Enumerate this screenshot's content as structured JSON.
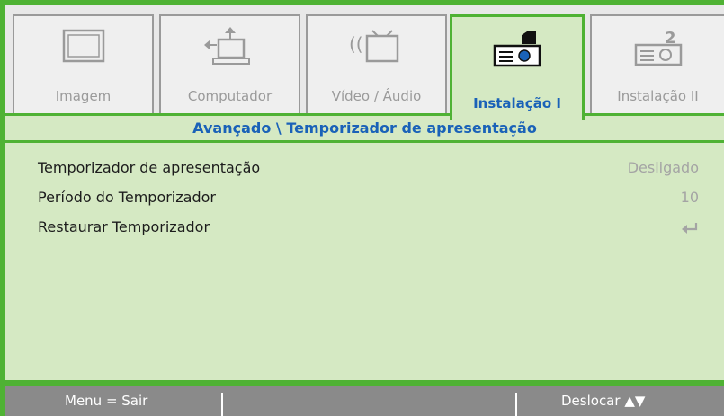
{
  "tabs": [
    {
      "label": "Imagem",
      "icon": "monitor-icon",
      "active": false
    },
    {
      "label": "Computador",
      "icon": "laptop-icon",
      "active": false
    },
    {
      "label": "Vídeo / Áudio",
      "icon": "video-audio-icon",
      "active": false
    },
    {
      "label": "Instalação I",
      "icon": "projector-setup-icon",
      "active": true
    },
    {
      "label": "Instalação II",
      "icon": "projector-setup-2-icon",
      "active": false
    }
  ],
  "breadcrumb": "Avançado \\ Temporizador de apresentação",
  "settings": [
    {
      "label": "Temporizador de apresentação",
      "value": "Desligado"
    },
    {
      "label": "Período do Temporizador",
      "value": "10"
    },
    {
      "label": "Restaurar Temporizador",
      "value_icon": "enter-icon"
    }
  ],
  "footer": {
    "menu_hint": "Menu = Sair",
    "move_hint": "Deslocar ▲▼"
  },
  "colors": {
    "frame": "#4fb234",
    "panel": "#d5e9c3",
    "active_text": "#1a62b8",
    "footer": "#8a8a8a"
  }
}
